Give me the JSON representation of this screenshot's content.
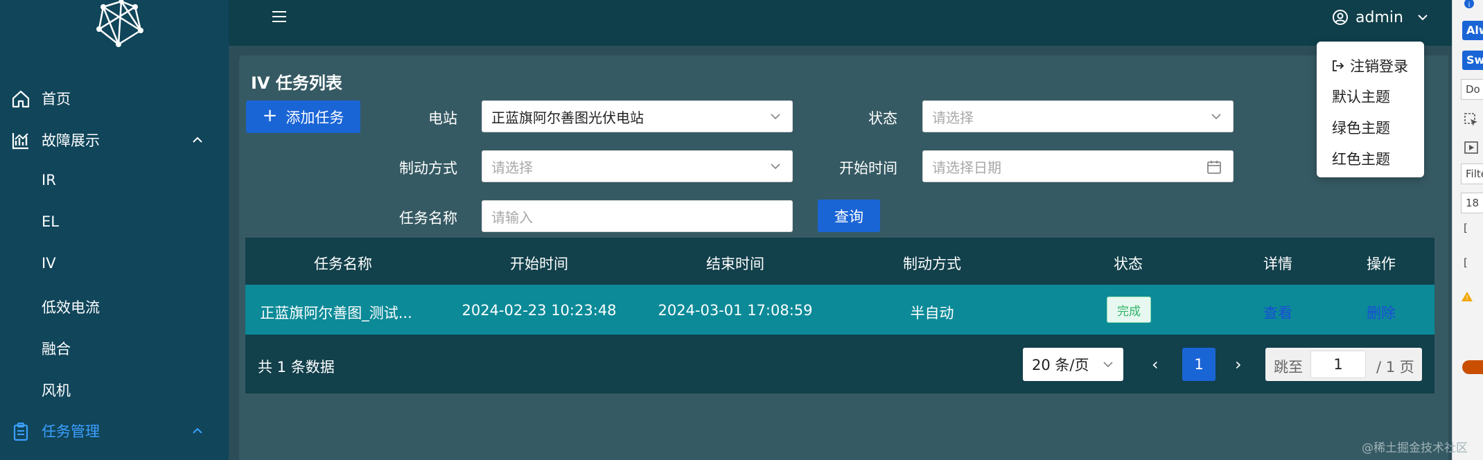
{
  "sidebar": {
    "items": [
      {
        "label": "首页",
        "icon": "home-icon"
      },
      {
        "label": "故障展示",
        "icon": "chart-icon",
        "expanded": true
      },
      {
        "label": "IR"
      },
      {
        "label": "EL"
      },
      {
        "label": "IV"
      },
      {
        "label": "低效电流"
      },
      {
        "label": "融合"
      },
      {
        "label": "风机"
      },
      {
        "label": "任务管理",
        "icon": "clipboard-icon",
        "expanded": true,
        "active": true
      }
    ]
  },
  "header": {
    "user": "admin"
  },
  "user_menu": {
    "items": [
      "注销登录",
      "默认主题",
      "绿色主题",
      "红色主题"
    ]
  },
  "page": {
    "title": "IV 任务列表",
    "add_button": "添加任务",
    "query_button": "查询"
  },
  "filters": {
    "station_label": "电站",
    "station_value": "正蓝旗阿尔善图光伏电站",
    "status_label": "状态",
    "status_placeholder": "请选择",
    "method_label": "制动方式",
    "method_placeholder": "请选择",
    "start_label": "开始时间",
    "start_placeholder": "请选择日期",
    "name_label": "任务名称",
    "name_placeholder": "请输入"
  },
  "table": {
    "columns": [
      "任务名称",
      "开始时间",
      "结束时间",
      "制动方式",
      "状态",
      "详情",
      "操作"
    ],
    "rows": [
      {
        "name": "正蓝旗阿尔善图_测试...",
        "start": "2024-02-23 10:23:48",
        "end": "2024-03-01 17:08:59",
        "method": "半自动",
        "status": "完成",
        "detail": "查看",
        "action": "删除"
      }
    ]
  },
  "pagination": {
    "total": "共 1 条数据",
    "page_size": "20 条/页",
    "current": "1",
    "jump_label": "跳至",
    "jump_value": "1",
    "jump_suffix": "/ 1 页"
  },
  "devtools": {
    "btn1": "Alw",
    "btn2": "Swi",
    "box1": "Do",
    "filter": "Filte",
    "count": "18"
  },
  "watermark": "@稀土掘金技术社区",
  "colors": {
    "sidebar_bg": "#10455a",
    "topbar_bg": "#0f3f4a",
    "content_bg": "#365a63",
    "accent": "#1a65d6",
    "row_bg": "#0c8a98",
    "active_menu": "#3ca0ff"
  }
}
